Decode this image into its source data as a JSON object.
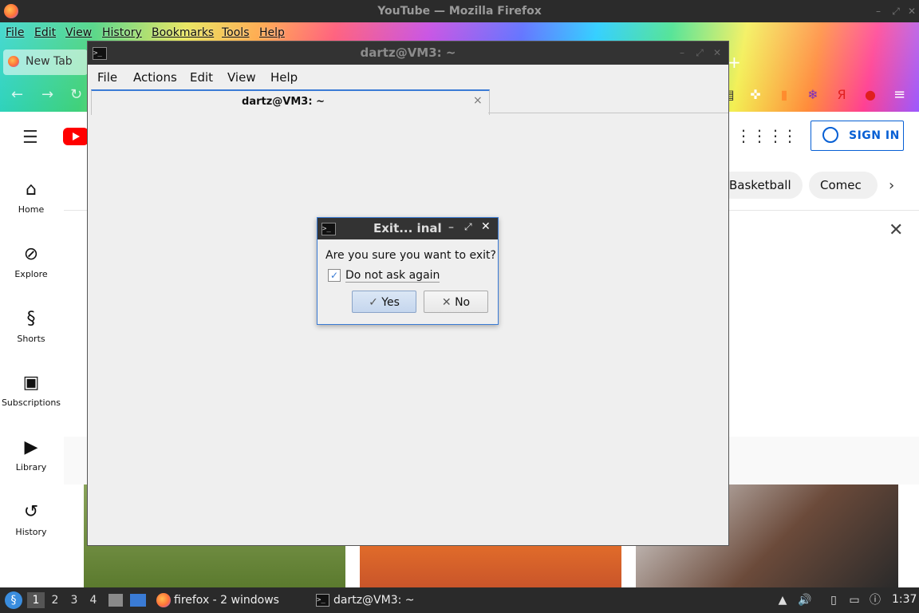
{
  "firefox": {
    "window_title": "YouTube — Mozilla Firefox",
    "menu": [
      "File",
      "Edit",
      "View",
      "History",
      "Bookmarks",
      "Tools",
      "Help"
    ],
    "tab_label": "New Tab",
    "new_tab_symbol": "+",
    "extensions": [
      "Я"
    ]
  },
  "youtube": {
    "sidebar": [
      {
        "label": "Home",
        "icon": "home-icon"
      },
      {
        "label": "Explore",
        "icon": "compass-icon"
      },
      {
        "label": "Shorts",
        "icon": "shorts-icon"
      },
      {
        "label": "Subscriptions",
        "icon": "subscriptions-icon"
      },
      {
        "label": "Library",
        "icon": "library-icon"
      },
      {
        "label": "History",
        "icon": "history-icon"
      }
    ],
    "sign_in": "SIGN IN",
    "chips": [
      "Basketball",
      "Comec"
    ],
    "brand_color": "#ff0000",
    "accent": "#065fd4"
  },
  "terminal": {
    "window_title": "dartz@VM3: ~",
    "menu": [
      "File",
      "Actions",
      "Edit",
      "View",
      "Help"
    ],
    "tab_label": "dartz@VM3: ~",
    "tab_close": "×"
  },
  "dialog": {
    "title": "Exit...   inal",
    "message": "Are you sure you want to exit?",
    "checkbox_label": "Do not ask again",
    "checkbox_checked": true,
    "yes_label": "Yes",
    "no_label": "No"
  },
  "taskbar": {
    "workspaces": [
      "1",
      "2",
      "3",
      "4"
    ],
    "active_workspace": "1",
    "firefox_task": "firefox - 2 windows",
    "terminal_task": "dartz@VM3: ~",
    "clock": "1:37"
  }
}
